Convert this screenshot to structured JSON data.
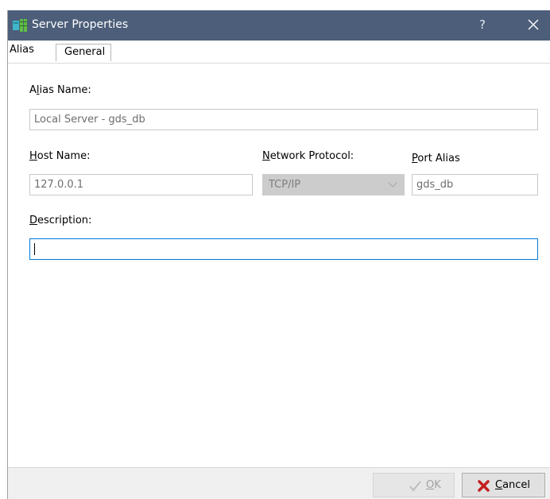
{
  "window": {
    "title": "Server Properties",
    "help": "?",
    "colors": {
      "titlebar": "#4c5e7a",
      "focus_border": "#0078d7",
      "cancel_icon": "#c41e1e"
    }
  },
  "tabs": [
    {
      "label": "Alias",
      "selected": true
    },
    {
      "label": "General",
      "selected": false
    }
  ],
  "form": {
    "alias_name": {
      "label_key": "A",
      "label_pre": "",
      "label_post": "lias Name:",
      "value": "Local Server - gds_db"
    },
    "host_name": {
      "label_key": "H",
      "label_post": "ost Name:",
      "value": "127.0.0.1"
    },
    "network_protocol": {
      "label_key": "N",
      "label_post": "etwork Protocol:",
      "value": "TCP/IP",
      "disabled": true
    },
    "port_alias": {
      "label_key": "P",
      "label_post": "ort Alias",
      "value": "gds_db"
    },
    "description": {
      "label_key": "D",
      "label_post": "escription:",
      "value": ""
    }
  },
  "buttons": {
    "ok": {
      "key": "O",
      "rest": "K",
      "enabled": false,
      "icon": "checkmark-icon"
    },
    "cancel": {
      "key": "C",
      "rest": "ancel",
      "enabled": true,
      "icon": "red-x-icon"
    }
  }
}
